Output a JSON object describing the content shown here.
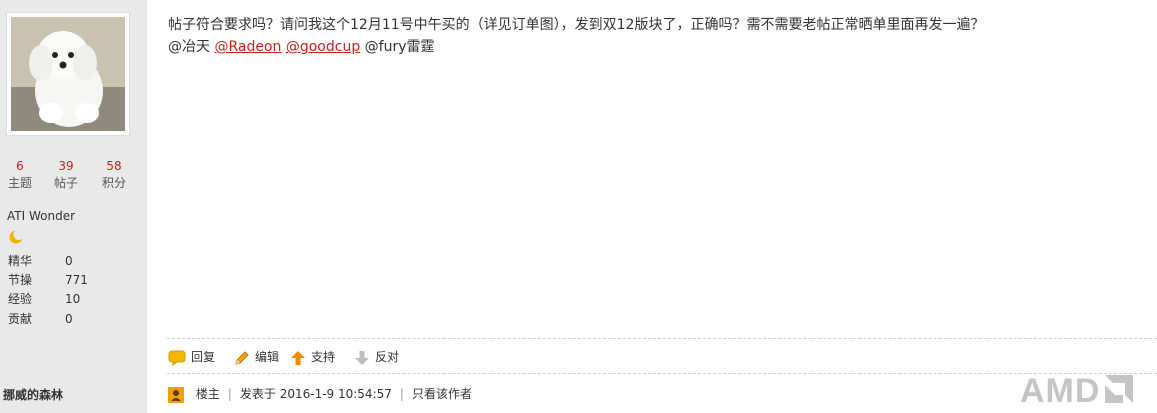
{
  "user": {
    "stats": [
      {
        "value": "6",
        "label": "主题"
      },
      {
        "value": "39",
        "label": "帖子"
      },
      {
        "value": "58",
        "label": "积分"
      }
    ],
    "group": "ATI Wonder",
    "details": [
      {
        "key": "精华",
        "value": "0"
      },
      {
        "key": "节操",
        "value": "771"
      },
      {
        "key": "经验",
        "value": "10"
      },
      {
        "key": "贡献",
        "value": "0"
      }
    ],
    "username": "挪威的森林"
  },
  "post": {
    "line1": "帖子符合要求吗？请问我这个12月11号中午买的（详见订单图），发到双12版块了，正确吗？需不需要老帖正常晒单里面再发一遍？",
    "mentions": {
      "plain1": "@冶天",
      "link1": "@Radeon",
      "link2": "@goodcup",
      "plain2": "@fury雷霆"
    }
  },
  "actions": {
    "reply": "回复",
    "edit": "编辑",
    "support": "支持",
    "oppose": "反对"
  },
  "meta": {
    "role": "楼主",
    "posted": "发表于 2016-1-9 10:54:57",
    "only_author": "只看该作者"
  },
  "watermark": "AMD",
  "icons": {
    "reply": "speech-bubble-icon",
    "edit": "pencil-icon",
    "support": "arrow-up-icon",
    "oppose": "arrow-down-icon",
    "author": "user-badge-icon",
    "group": "moon-icon"
  },
  "colors": {
    "accent": "#c81e1e",
    "sidebar_bg": "#e9e9e9",
    "support_arrow": "#f08c00",
    "oppose_arrow": "#bdbdbd"
  }
}
